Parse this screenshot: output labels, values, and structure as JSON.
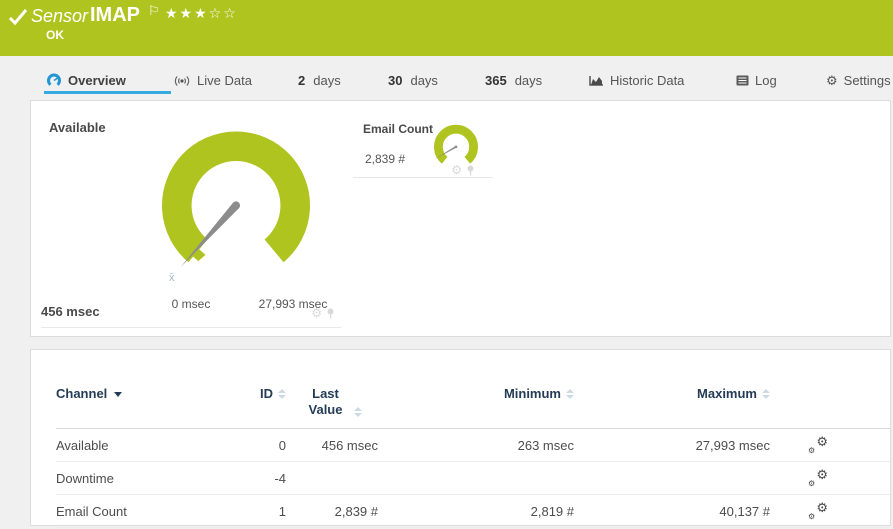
{
  "colors": {
    "accent_green": "#b0c420",
    "tab_active_blue": "#36a9e1",
    "table_header_blue": "#253c56"
  },
  "icons": {
    "priority_flag": "⚐",
    "gear": "⚙",
    "avg_marker": "x̄"
  },
  "header": {
    "title_prefix": "Sensor",
    "title": "IMAP",
    "status": "OK",
    "rating_stars": "★★★☆☆"
  },
  "tabs": {
    "overview": "Overview",
    "live_data": "Live Data",
    "d2_num": "2",
    "d2_label": "days",
    "d30_num": "30",
    "d30_label": "days",
    "d365_num": "365",
    "d365_label": "days",
    "historic": "Historic Data",
    "log": "Log",
    "settings": "Settings"
  },
  "gauges": {
    "available": {
      "label": "Available",
      "value": "456 msec",
      "value_num": 456,
      "unit": "msec",
      "scale_min_label": "0 msec",
      "scale_max_label": "27,993 msec",
      "scale_min": 0,
      "scale_max": 27993
    },
    "email_count": {
      "label": "Email Count",
      "value": "2,839 #",
      "value_num": 2839,
      "unit": "#"
    }
  },
  "table": {
    "headers": {
      "channel": "Channel",
      "id": "ID",
      "last_value": "Last Value",
      "minimum": "Minimum",
      "maximum": "Maximum"
    },
    "rows": [
      {
        "channel": "Available",
        "id": "0",
        "last_value": "456 msec",
        "minimum": "263 msec",
        "maximum": "27,993 msec"
      },
      {
        "channel": "Downtime",
        "id": "-4",
        "last_value": "",
        "minimum": "",
        "maximum": ""
      },
      {
        "channel": "Email Count",
        "id": "1",
        "last_value": "2,839 #",
        "minimum": "2,819 #",
        "maximum": "40,137 #"
      }
    ]
  }
}
